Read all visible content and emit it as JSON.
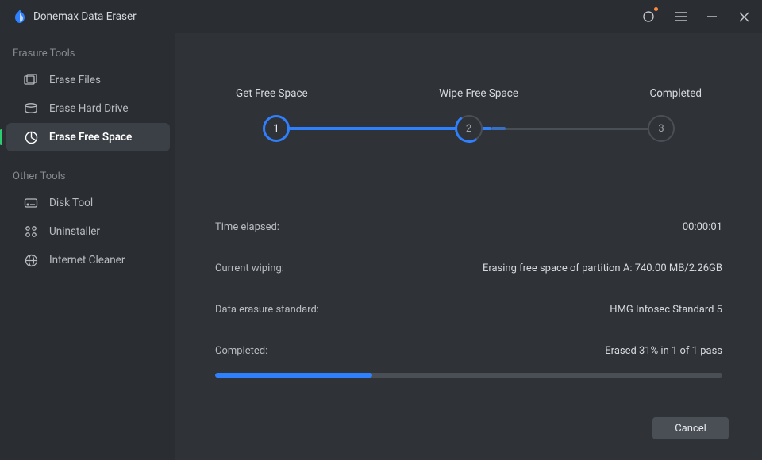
{
  "app": {
    "title": "Donemax Data Eraser"
  },
  "sidebar": {
    "section1_label": "Erasure Tools",
    "items1": [
      {
        "label": "Erase Files"
      },
      {
        "label": "Erase Hard Drive"
      },
      {
        "label": "Erase Free Space"
      }
    ],
    "section2_label": "Other Tools",
    "items2": [
      {
        "label": "Disk Tool"
      },
      {
        "label": "Uninstaller"
      },
      {
        "label": "Internet Cleaner"
      }
    ]
  },
  "stepper": {
    "steps": [
      {
        "num": "1",
        "label": "Get Free Space"
      },
      {
        "num": "2",
        "label": "Wipe Free Space"
      },
      {
        "num": "3",
        "label": "Completed"
      }
    ]
  },
  "details": {
    "time_label": "Time elapsed:",
    "time_value": "00:00:01",
    "wiping_label": "Current wiping:",
    "wiping_value": "Erasing free space of partition A: 740.00 MB/2.26GB",
    "standard_label": "Data erasure standard:",
    "standard_value": "HMG Infosec Standard 5",
    "completed_label": "Completed:",
    "completed_value": "Erased 31% in 1 of 1 pass"
  },
  "progress": {
    "percent": 31
  },
  "buttons": {
    "cancel": "Cancel"
  }
}
